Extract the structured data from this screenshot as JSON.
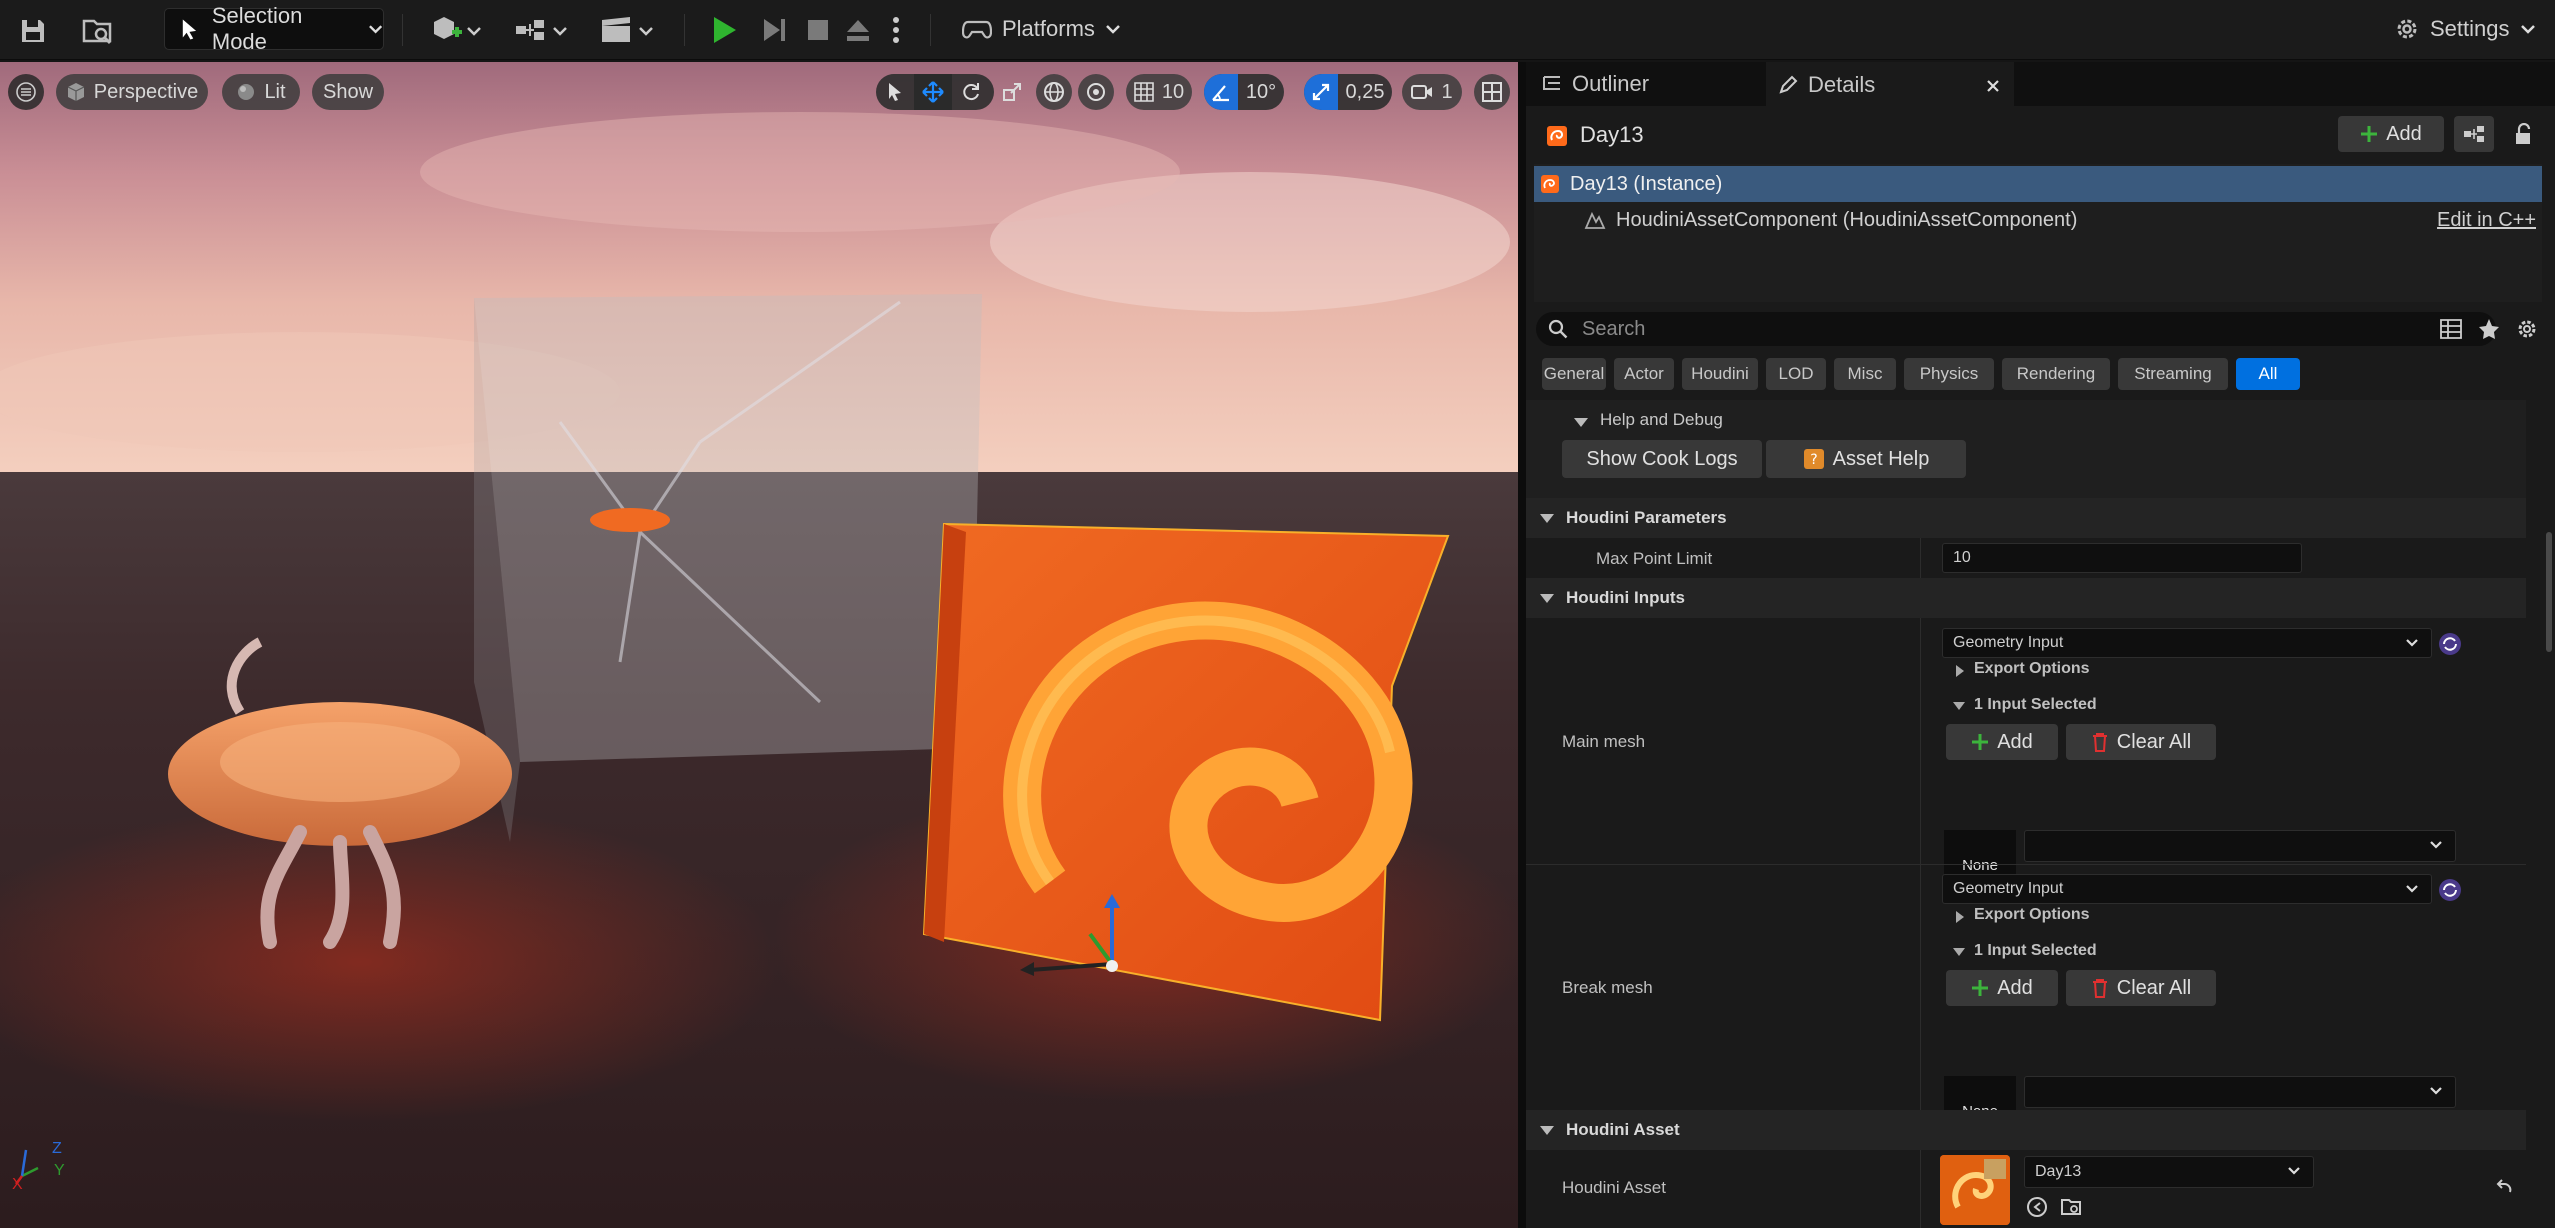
{
  "toolbar": {
    "mode_label": "Selection Mode",
    "platforms_label": "Platforms",
    "settings_label": "Settings"
  },
  "viewport": {
    "perspective_label": "Perspective",
    "lit_label": "Lit",
    "show_label": "Show",
    "grid_value": "10",
    "angle_value": "10°",
    "scale_value": "0,25",
    "camera_speed": "1",
    "axis_x": "X",
    "axis_y": "Y",
    "axis_z": "Z"
  },
  "tabs": {
    "outliner": "Outliner",
    "details": "Details"
  },
  "details": {
    "actor_name": "Day13",
    "add_label": "Add",
    "instance_label": "Day13 (Instance)",
    "component_label": "HoudiniAssetComponent (HoudiniAssetComponent)",
    "edit_cpp_label": "Edit in C++",
    "search_placeholder": "Search",
    "filters": [
      "General",
      "Actor",
      "Houdini",
      "LOD",
      "Misc",
      "Physics",
      "Rendering",
      "Streaming",
      "All"
    ]
  },
  "help": {
    "section_label": "Help and Debug",
    "cook_logs_label": "Show Cook Logs",
    "asset_help_label": "Asset Help"
  },
  "parameters": {
    "section_label": "Houdini Parameters",
    "max_point_label": "Max Point Limit",
    "max_point_value": "10"
  },
  "inputs": {
    "section_label": "Houdini Inputs",
    "items": [
      {
        "label": "Main mesh",
        "type": "Geometry Input",
        "export_label": "Export Options",
        "selected_label": "1 Input Selected",
        "add_label": "Add",
        "clear_label": "Clear All",
        "thumb_label": "None"
      },
      {
        "label": "Break mesh",
        "type": "Geometry Input",
        "export_label": "Export Options",
        "selected_label": "1 Input Selected",
        "add_label": "Add",
        "clear_label": "Clear All",
        "thumb_label": "None"
      }
    ]
  },
  "asset": {
    "section_label": "Houdini Asset",
    "row_label": "Houdini Asset",
    "value": "Day13"
  },
  "colors": {
    "accent": "#0070e0",
    "selection": "#3a5a7e",
    "play_green": "#2fb52f",
    "houdini_orange": "#ff6a1a"
  }
}
